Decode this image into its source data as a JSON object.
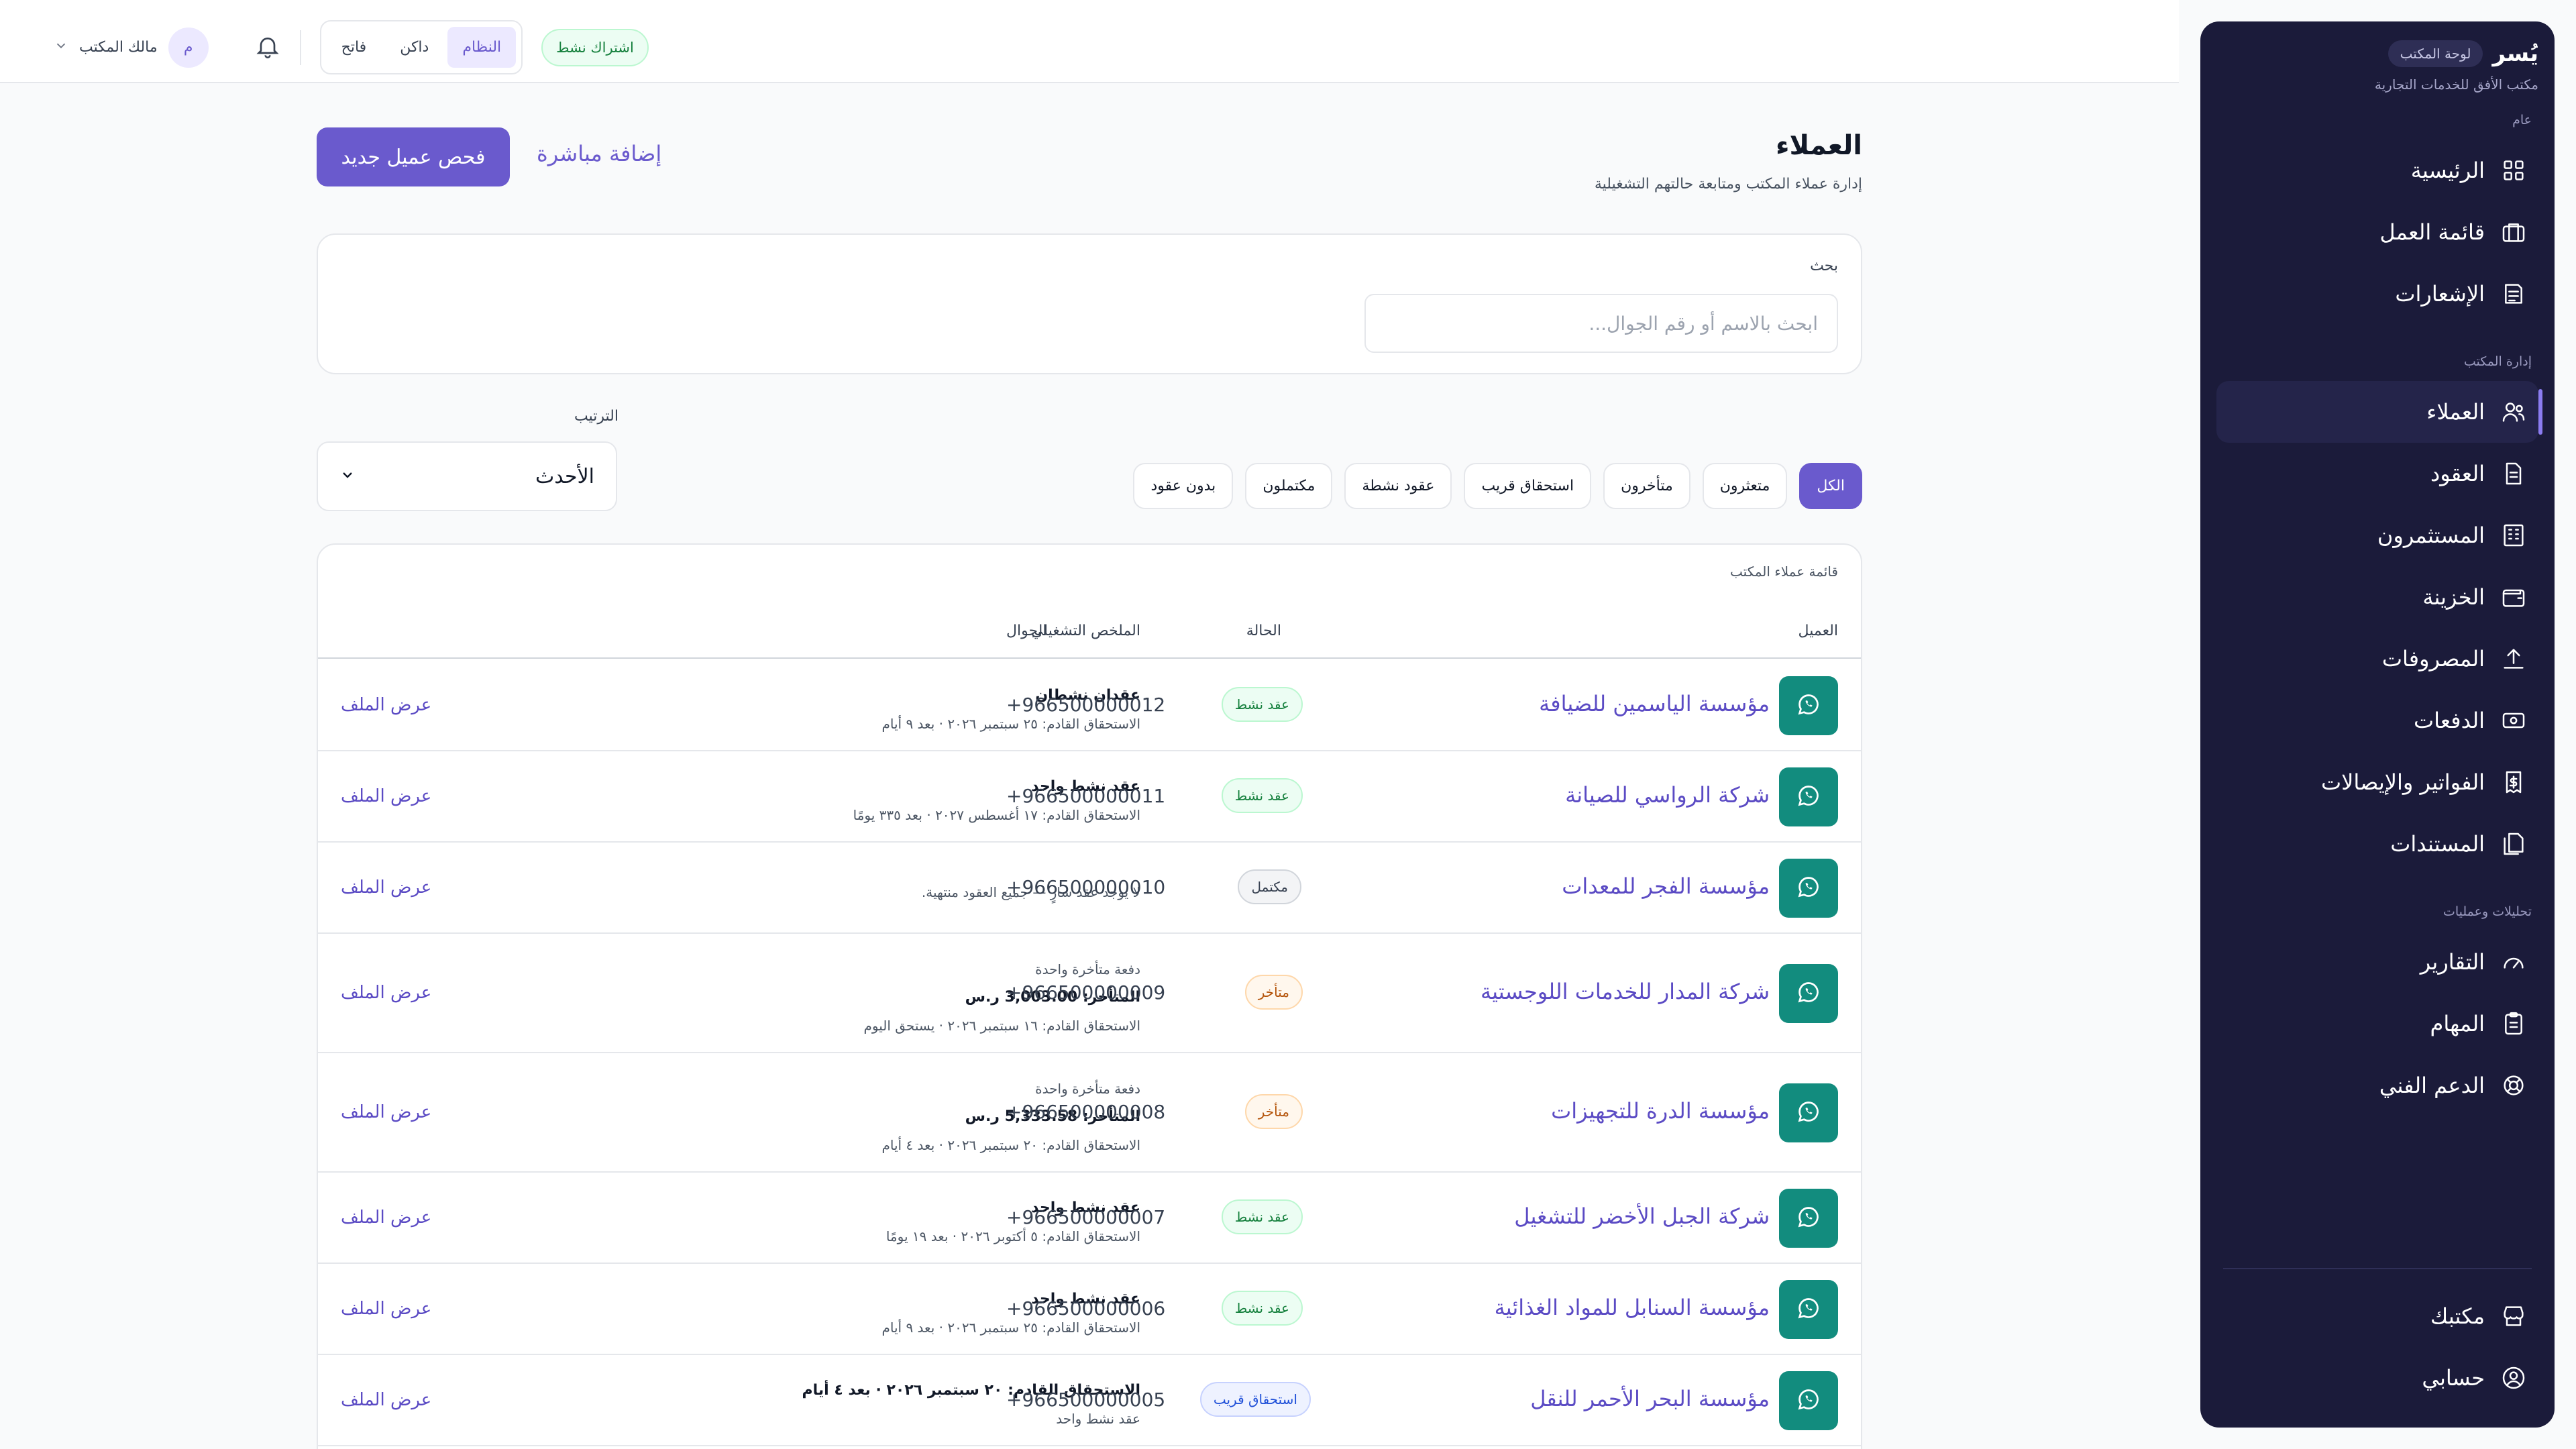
{
  "sidebar": {
    "logo": "يُسر",
    "chip": "لوحة المكتب",
    "office_name": "مكتب الأفق للخدمات التجارية",
    "sections": [
      "عام",
      "إدارة المكتب",
      "تحليلات وعمليات"
    ],
    "general": [
      {
        "label": "الرئيسية",
        "icon": "dashboard-icon"
      },
      {
        "label": "قائمة العمل",
        "icon": "briefcase-icon"
      },
      {
        "label": "الإشعارات",
        "icon": "notifications-list-icon"
      }
    ],
    "office": [
      {
        "label": "العملاء",
        "icon": "users-icon",
        "active": true
      },
      {
        "label": "العقود",
        "icon": "document-icon"
      },
      {
        "label": "المستثمرون",
        "icon": "building-icon"
      },
      {
        "label": "الخزينة",
        "icon": "wallet-icon"
      },
      {
        "label": "المصروفات",
        "icon": "upload-icon"
      },
      {
        "label": "الدفعات",
        "icon": "cash-icon"
      },
      {
        "label": "الفواتير والإيصالات",
        "icon": "receipt-icon"
      },
      {
        "label": "المستندات",
        "icon": "files-icon"
      }
    ],
    "analytics": [
      {
        "label": "التقارير",
        "icon": "gauge-icon"
      },
      {
        "label": "المهام",
        "icon": "clipboard-icon"
      },
      {
        "label": "الدعم الفني",
        "icon": "lifebuoy-icon"
      }
    ],
    "bottom": [
      {
        "label": "مكتبك",
        "icon": "store-icon"
      },
      {
        "label": "حسابي",
        "icon": "user-circle-icon"
      }
    ]
  },
  "topbar": {
    "user_name": "مالك المكتب",
    "avatar_initial": "م",
    "modes": [
      "النظام",
      "داكن",
      "فاتح"
    ],
    "active_mode": "النظام",
    "subscription": "اشتراك نشط"
  },
  "page": {
    "title": "العملاء",
    "subtitle": "إدارة عملاء المكتب ومتابعة حالتهم التشغيلية",
    "primary_button": "فحص عميل جديد",
    "secondary_button": "إضافة مباشرة"
  },
  "search": {
    "label": "بحث",
    "placeholder": "ابحث بالاسم أو رقم الجوال..."
  },
  "sort": {
    "label": "الترتيب",
    "value": "الأحدث"
  },
  "filters": [
    "الكل",
    "متعثرون",
    "متأخرون",
    "استحقاق قريب",
    "عقود نشطة",
    "مكتملون",
    "بدون عقود"
  ],
  "table": {
    "caption": "قائمة عملاء المكتب",
    "headers": {
      "client": "العميل",
      "status": "الحالة",
      "summary": "الملخص التشغيلي",
      "phone": "الجوال"
    },
    "view_label": "عرض الملف",
    "rows": [
      {
        "name": "مؤسسة الياسمين للضيافة",
        "status": "عقد نشط",
        "status_kind": "active",
        "lines": [
          {
            "t": "عقدان نشطان",
            "k": "strong"
          },
          {
            "t": "الاستحقاق القادم: ٢٥ سبتمبر ٢٠٢٦ · بعد ٩ أيام",
            "k": "small"
          }
        ],
        "phone": "+966500000012"
      },
      {
        "name": "شركة الرواسي للصيانة",
        "status": "عقد نشط",
        "status_kind": "active",
        "lines": [
          {
            "t": "عقد نشط واحد",
            "k": "strong"
          },
          {
            "t": "الاستحقاق القادم: ١٧ أغسطس ٢٠٢٧ · بعد ٣٣٥ يومًا",
            "k": "small"
          }
        ],
        "phone": "+966500000011"
      },
      {
        "name": "مؤسسة الفجر للمعدات",
        "status": "مكتمل",
        "status_kind": "done",
        "lines": [
          {
            "t": "لا يوجد عقد سارٍ — جميع العقود منتهية.",
            "k": "small"
          }
        ],
        "phone": "+966500000010"
      },
      {
        "name": "شركة المدار للخدمات اللوجستية",
        "status": "متأخر",
        "status_kind": "late",
        "lines": [
          {
            "t": "دفعة متأخرة واحدة",
            "k": "muted"
          },
          {
            "t": "المتأخر: 3,003.00 ر.س",
            "k": "strong"
          },
          {
            "t": "الاستحقاق القادم: ١٦ سبتمبر ٢٠٢٦ · يستحق اليوم",
            "k": "small"
          }
        ],
        "phone": "+966500000009"
      },
      {
        "name": "مؤسسة الدرة للتجهيزات",
        "status": "متأخر",
        "status_kind": "late",
        "lines": [
          {
            "t": "دفعة متأخرة واحدة",
            "k": "muted"
          },
          {
            "t": "المتأخر: 5,333.58 ر.س",
            "k": "strong"
          },
          {
            "t": "الاستحقاق القادم: ٢٠ سبتمبر ٢٠٢٦ · بعد ٤ أيام",
            "k": "small"
          }
        ],
        "phone": "+966500000008"
      },
      {
        "name": "شركة الجبل الأخضر للتشغيل",
        "status": "عقد نشط",
        "status_kind": "active",
        "lines": [
          {
            "t": "عقد نشط واحد",
            "k": "strong"
          },
          {
            "t": "الاستحقاق القادم: ٥ أكتوبر ٢٠٢٦ · بعد ١٩ يومًا",
            "k": "small"
          }
        ],
        "phone": "+966500000007"
      },
      {
        "name": "مؤسسة السنابل للمواد الغذائية",
        "status": "عقد نشط",
        "status_kind": "active",
        "lines": [
          {
            "t": "عقد نشط واحد",
            "k": "strong"
          },
          {
            "t": "الاستحقاق القادم: ٢٥ سبتمبر ٢٠٢٦ · بعد ٩ أيام",
            "k": "small"
          }
        ],
        "phone": "+966500000006"
      },
      {
        "name": "مؤسسة البحر الأحمر للنقل",
        "status": "استحقاق قريب",
        "status_kind": "soon",
        "lines": [
          {
            "t": "الاستحقاق القادم: ٢٠ سبتمبر ٢٠٢٦ · بعد ٤ أيام",
            "k": "strong"
          },
          {
            "t": "عقد نشط واحد",
            "k": "small"
          }
        ],
        "phone": "+966500000005"
      }
    ]
  }
}
